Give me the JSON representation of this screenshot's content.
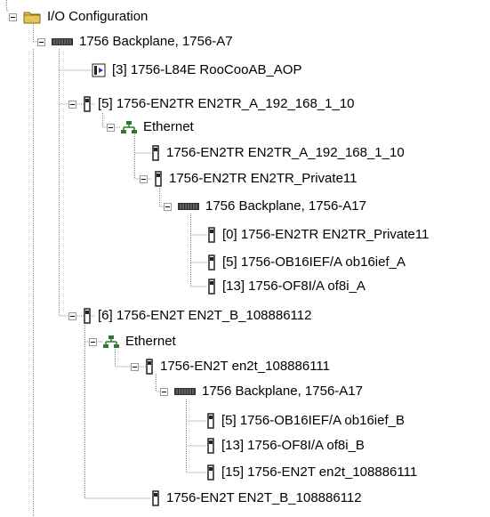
{
  "tree": {
    "root": {
      "label": "I/O Configuration",
      "icon": "folder-icon"
    },
    "backplane": {
      "label": "1756 Backplane, 1756-A7",
      "icon": "backplane-icon"
    },
    "slot3": {
      "label": "[3] 1756-L84E RooCooAB_AOP",
      "icon": "controller-icon"
    },
    "slot5": {
      "label": "[5] 1756-EN2TR EN2TR_A_192_168_1_10",
      "icon": "module-icon"
    },
    "slot5_eth": {
      "label": "Ethernet",
      "icon": "network-icon"
    },
    "slot5_eth_self": {
      "label": "1756-EN2TR EN2TR_A_192_168_1_10",
      "icon": "module-icon"
    },
    "slot5_eth_private": {
      "label": "1756-EN2TR EN2TR_Private11",
      "icon": "module-icon"
    },
    "slot5_private_bp": {
      "label": "1756 Backplane, 1756-A17",
      "icon": "backplane-icon"
    },
    "private_slot0": {
      "label": "[0] 1756-EN2TR EN2TR_Private11",
      "icon": "module-icon"
    },
    "private_slot5": {
      "label": "[5] 1756-OB16IEF/A ob16ief_A",
      "icon": "module-icon"
    },
    "private_slot13": {
      "label": "[13] 1756-OF8I/A of8i_A",
      "icon": "module-icon"
    },
    "slot6": {
      "label": "[6] 1756-EN2T EN2T_B_108886112",
      "icon": "module-icon"
    },
    "slot6_eth": {
      "label": "Ethernet",
      "icon": "network-icon"
    },
    "slot6_eth_remote": {
      "label": "1756-EN2T en2t_108886111",
      "icon": "module-icon"
    },
    "remote_bp": {
      "label": "1756 Backplane, 1756-A17",
      "icon": "backplane-icon"
    },
    "remote_slot5": {
      "label": "[5] 1756-OB16IEF/A ob16ief_B",
      "icon": "module-icon"
    },
    "remote_slot13": {
      "label": "[13] 1756-OF8I/A of8i_B",
      "icon": "module-icon"
    },
    "remote_slot15": {
      "label": "[15] 1756-EN2T en2t_108886111",
      "icon": "module-icon"
    },
    "slot6_eth_self": {
      "label": "1756-EN2T EN2T_B_108886112",
      "icon": "module-icon"
    }
  },
  "colors": {
    "folder": "#e8c25a",
    "network": "#2a7a2a",
    "module": "#2b2b2b",
    "connector": "#8c8c8c"
  }
}
